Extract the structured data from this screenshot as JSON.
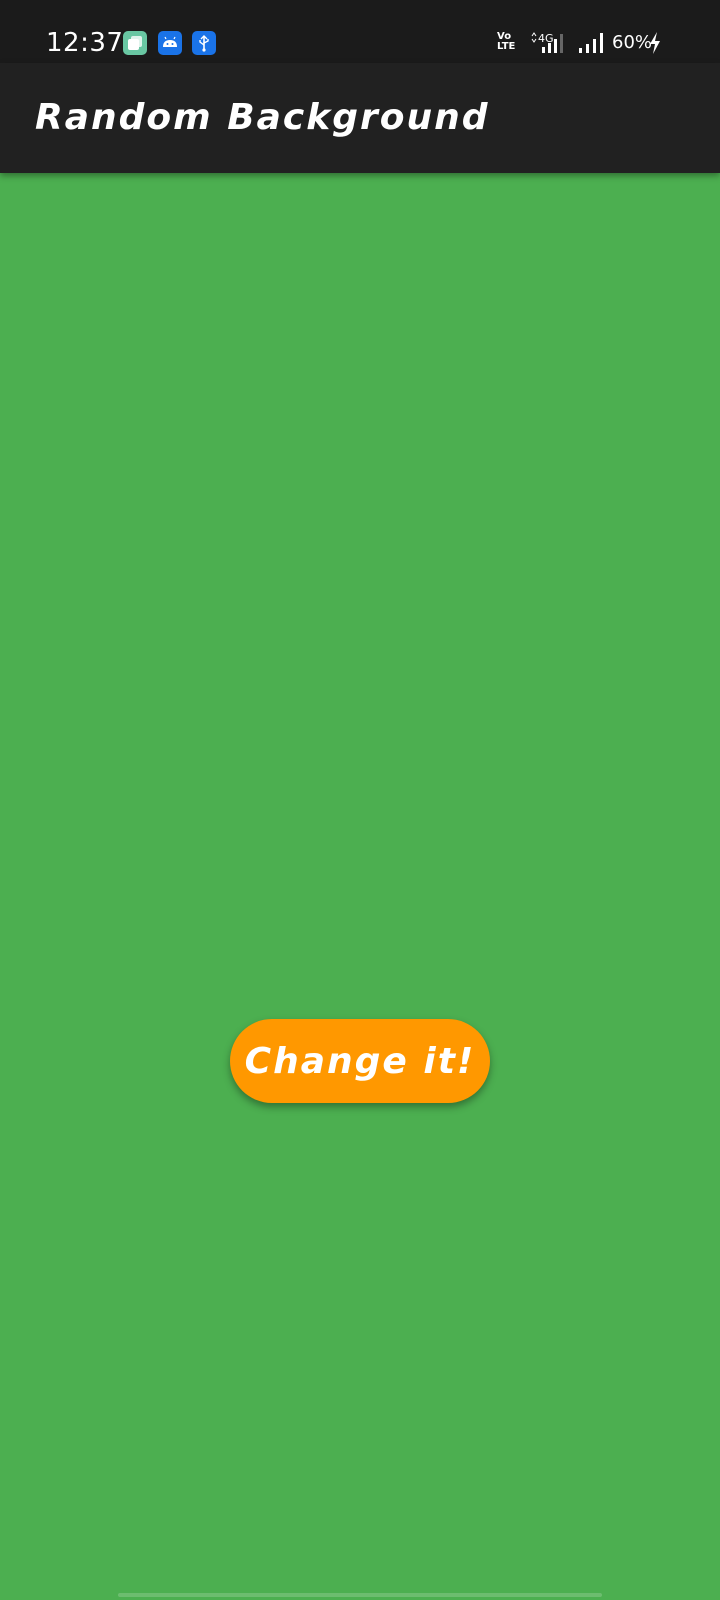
{
  "status_bar": {
    "time": "12:37",
    "notification_icons": [
      "stacked-windows-icon",
      "android-icon",
      "usb-icon"
    ],
    "volte_top": "Vo",
    "volte_bottom": "LTE",
    "network_label": "4G",
    "battery_percent": "60%",
    "charging": true
  },
  "app_bar": {
    "title": "Random Background"
  },
  "main": {
    "background_color": "#4caf50",
    "button_label": "Change it!",
    "button_color": "#ff9800"
  },
  "colors": {
    "status_bar": "#1b1b1b",
    "app_bar": "#212121",
    "accent": "#ff9800",
    "background": "#4caf50"
  }
}
